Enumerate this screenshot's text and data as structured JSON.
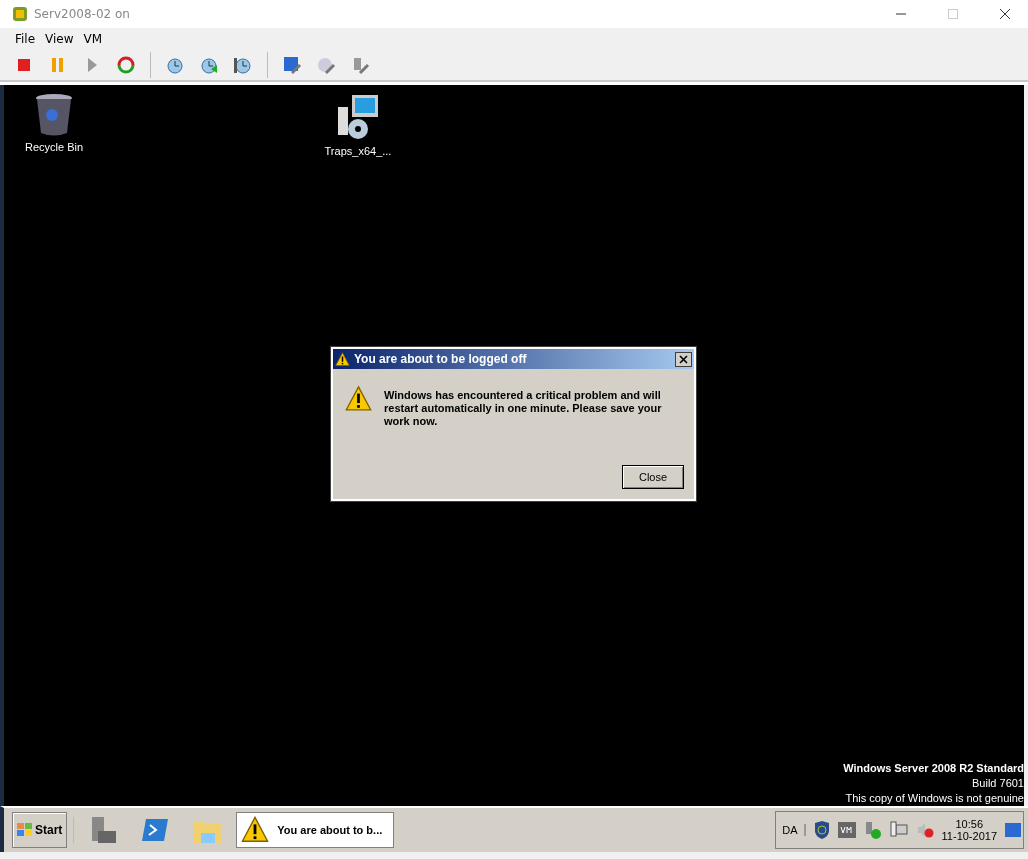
{
  "window": {
    "title": "Serv2008-02 on"
  },
  "menu": [
    "File",
    "View",
    "VM"
  ],
  "desktop": {
    "icons": [
      {
        "label": "Recycle Bin",
        "kind": "bin"
      },
      {
        "label": "Traps_x64_...",
        "kind": "installer"
      }
    ],
    "dialog": {
      "title": "You are about to be logged off",
      "message": "Windows has encountered a critical problem and will restart automatically in one minute. Please save your work now.",
      "button": "Close"
    },
    "edition": {
      "name": "Windows Server 2008 R2 Standard",
      "build": "Build 7601",
      "notice": "This copy of Windows is not genuine"
    }
  },
  "taskbar": {
    "start": "Start",
    "task": "You are about to b...",
    "language": "DA",
    "time": "10:56",
    "date": "11-10-2017"
  }
}
